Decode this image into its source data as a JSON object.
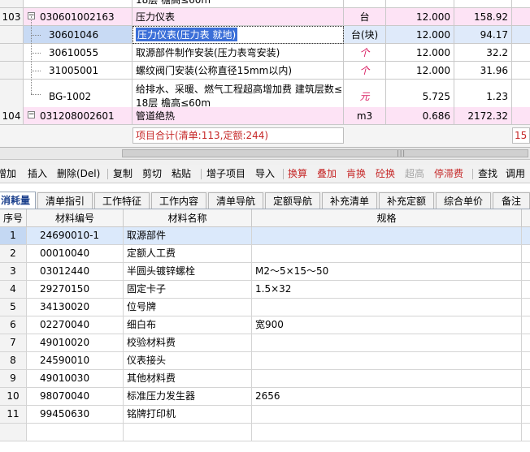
{
  "top_grid": {
    "cutoff_text": "18层 檐高≤60m",
    "rows": [
      {
        "num": "103",
        "code": "030601002163",
        "name": "压力仪表",
        "unit": "台",
        "qty": "12.000",
        "price": "158.92",
        "type": "item"
      },
      {
        "num": "",
        "code": "30601046",
        "name": "压力仪表(压力表 就地)",
        "unit": "台(块)",
        "qty": "12.000",
        "price": "94.17",
        "type": "selected"
      },
      {
        "num": "",
        "code": "30610055",
        "name": "取源部件制作安装(压力表弯安装)",
        "unit": "个",
        "qty": "12.000",
        "price": "32.2",
        "type": "sub"
      },
      {
        "num": "",
        "code": "31005001",
        "name": "螺纹阀门安装(公称直径15mm以内)",
        "unit": "个",
        "qty": "12.000",
        "price": "31.96",
        "type": "sub"
      },
      {
        "num": "",
        "code": "BG-1002",
        "name_line1": "给排水、采暖、燃气工程超高增加费 建筑层数≤",
        "name_line2": "18层 檐高≤60m",
        "unit": "元",
        "qty": "5.725",
        "price": "1.23",
        "type": "tall"
      },
      {
        "num": "104",
        "code": "031208002601",
        "name": "管道绝热",
        "unit": "m3",
        "qty": "0.686",
        "price": "2172.32",
        "type": "item"
      }
    ],
    "summary_text": "项目合计(清单:113,定额:244)",
    "summary_right": "15"
  },
  "toolbar": {
    "buttons": [
      {
        "label": "增加",
        "style": "normal"
      },
      {
        "label": "插入",
        "style": "normal"
      },
      {
        "label": "删除(Del)",
        "style": "normal"
      },
      {
        "label": "复制",
        "style": "normal"
      },
      {
        "label": "剪切",
        "style": "normal"
      },
      {
        "label": "粘贴",
        "style": "normal"
      },
      {
        "label": "增子项目",
        "style": "normal"
      },
      {
        "label": "导入",
        "style": "normal"
      },
      {
        "label": "换算",
        "style": "red"
      },
      {
        "label": "叠加",
        "style": "red"
      },
      {
        "label": "肯换",
        "style": "red"
      },
      {
        "label": "砼换",
        "style": "red"
      },
      {
        "label": "超高",
        "style": "gray"
      },
      {
        "label": "停滞费",
        "style": "red"
      },
      {
        "label": "查找",
        "style": "normal"
      },
      {
        "label": "调用",
        "style": "normal"
      }
    ]
  },
  "tabs": [
    {
      "label": "消耗量",
      "active": true
    },
    {
      "label": "清单指引",
      "active": false
    },
    {
      "label": "工作特征",
      "active": false
    },
    {
      "label": "工作内容",
      "active": false
    },
    {
      "label": "清单导航",
      "active": false
    },
    {
      "label": "定额导航",
      "active": false
    },
    {
      "label": "补充清单",
      "active": false
    },
    {
      "label": "补充定额",
      "active": false
    },
    {
      "label": "综合单价",
      "active": false
    },
    {
      "label": "备注",
      "active": false
    }
  ],
  "lower_grid": {
    "headers": {
      "num": "序号",
      "code": "材料编号",
      "name": "材料名称",
      "spec": "规格"
    },
    "rows": [
      {
        "num": "1",
        "code": "24690010-1",
        "name": "取源部件",
        "spec": ""
      },
      {
        "num": "2",
        "code": "00010040",
        "name": "定额人工费",
        "spec": ""
      },
      {
        "num": "3",
        "code": "03012440",
        "name": "半圆头镀锌螺栓",
        "spec": "M2～5×15～50"
      },
      {
        "num": "4",
        "code": "29270150",
        "name": "固定卡子",
        "spec": "1.5×32"
      },
      {
        "num": "5",
        "code": "34130020",
        "name": "位号牌",
        "spec": ""
      },
      {
        "num": "6",
        "code": "02270040",
        "name": "细白布",
        "spec": "宽900"
      },
      {
        "num": "7",
        "code": "49010020",
        "name": "校验材料费",
        "spec": ""
      },
      {
        "num": "8",
        "code": "24590010",
        "name": "仪表接头",
        "spec": ""
      },
      {
        "num": "9",
        "code": "49010030",
        "name": "其他材料费",
        "spec": ""
      },
      {
        "num": "10",
        "code": "98070040",
        "name": "标准压力发生器",
        "spec": "2656"
      },
      {
        "num": "11",
        "code": "99450630",
        "name": "铭牌打印机",
        "spec": ""
      }
    ]
  }
}
